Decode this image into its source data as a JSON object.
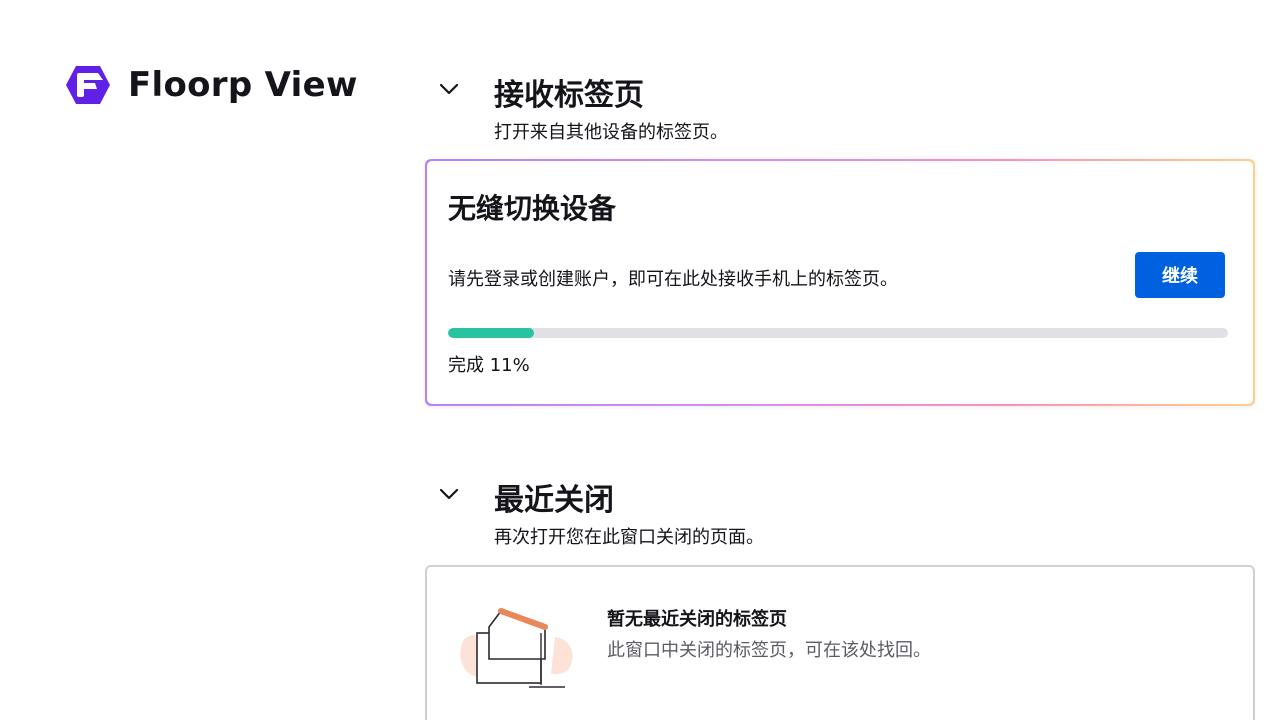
{
  "brand": {
    "logo_icon": "floorp-logo-icon",
    "title": "Floorp View"
  },
  "tabs_from_devices": {
    "toggle_icon": "chevron-down-icon",
    "title": "接收标签页",
    "description": "打开来自其他设备的标签页。",
    "card": {
      "title": "无缝切换设备",
      "text": "请先登录或创建账户，即可在此处接收手机上的标签页。",
      "button_label": "继续",
      "progress_percent": 11,
      "progress_label": "完成 11%"
    }
  },
  "recently_closed": {
    "toggle_icon": "chevron-down-icon",
    "title": "最近关闭",
    "description": "再次打开您在此窗口关闭的页面。",
    "empty_state": {
      "illustration_icon": "empty-folder-illustration-icon",
      "title": "暂无最近关闭的标签页",
      "description": "此窗口中关闭的标签页，可在该处找回。"
    }
  },
  "colors": {
    "accent": "#0061e0",
    "progress": "#2ac3a2",
    "logo": "#6020e6"
  }
}
